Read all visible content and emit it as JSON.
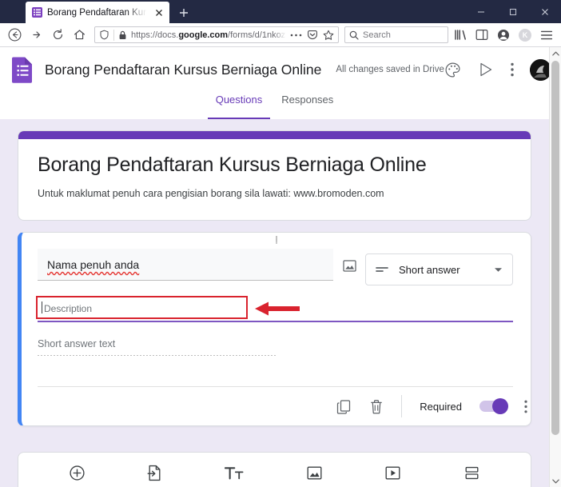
{
  "browser": {
    "tab": {
      "title": "Borang Pendaftaran Kursus Ber",
      "favicon_name": "google-forms-favicon",
      "close_label": "✕"
    },
    "new_tab_label": "+",
    "window_controls": {
      "minimize": "–",
      "maximize": "□",
      "close": "✕"
    },
    "nav": {
      "back": "←",
      "forward": "→",
      "reload": "↻",
      "home": "⌂"
    },
    "url": {
      "prefix": "https://docs.",
      "domain": "google.com",
      "path": "/forms/d/1nkoz",
      "full": "https://docs.google.com/forms/d/1nkoz"
    },
    "search": {
      "placeholder": "Search"
    },
    "toolbar_icons": [
      "library-icon",
      "sidebar-icon",
      "account-icon",
      "container-icon",
      "menu-icon"
    ],
    "account_badge": "K"
  },
  "forms": {
    "app_logo": "google-forms-logo",
    "document_title": "Borang Pendaftaran Kursus Berniaga Online",
    "save_status": "All changes saved in Drive",
    "actions": {
      "theme": "palette-icon",
      "preview": "send-icon",
      "more": "more-vert-icon",
      "avatar": "user-avatar"
    },
    "tabs": [
      {
        "label": "Questions",
        "active": true
      },
      {
        "label": "Responses",
        "active": false
      }
    ],
    "title_card": {
      "title": "Borang Pendaftaran Kursus Berniaga Online",
      "description": "Untuk maklumat penuh cara pengisian borang sila lawati: www.bromoden.com",
      "accent_color": "#673ab7"
    },
    "question": {
      "drag_handle": "drag-handle-icon",
      "title": "Nama penuh anda",
      "add_image": "image-icon",
      "type": {
        "label": "Short answer",
        "icon": "short-answer-icon",
        "chevron": "chevron-down-icon"
      },
      "description_placeholder": "Description",
      "answer_placeholder": "Short answer text",
      "footer": {
        "duplicate": "duplicate-icon",
        "delete": "trash-icon",
        "required_label": "Required",
        "required_on": true,
        "more": "more-vert-icon"
      },
      "selected_accent": "#4285f4",
      "highlight_color": "#d9232e"
    },
    "add_toolbar": [
      "add-question-icon",
      "import-questions-icon",
      "add-title-icon",
      "add-image-icon",
      "add-video-icon",
      "add-section-icon"
    ]
  }
}
